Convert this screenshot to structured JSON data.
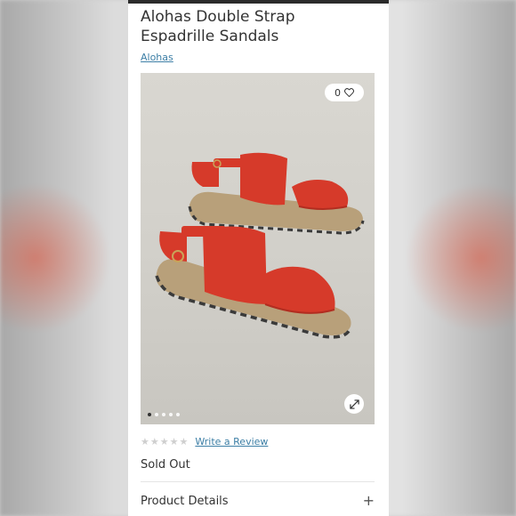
{
  "product": {
    "title": "Alohas Double Strap Espadrille Sandals",
    "brand": "Alohas"
  },
  "gallery": {
    "favorite_count": "0",
    "favorite_icon": "heart-icon",
    "zoom_icon": "expand-icon",
    "slide_count": 5,
    "active_slide": 1
  },
  "reviews": {
    "rating": 0,
    "max_rating": 5,
    "link_label": "Write a Review"
  },
  "availability": {
    "status": "Sold Out"
  },
  "accordion": {
    "details_label": "Product Details",
    "expand_icon": "plus-icon"
  },
  "colors": {
    "link": "#3d7fa6",
    "sandal_strap": "#d63a2a",
    "topbar": "#2b2b2b"
  }
}
